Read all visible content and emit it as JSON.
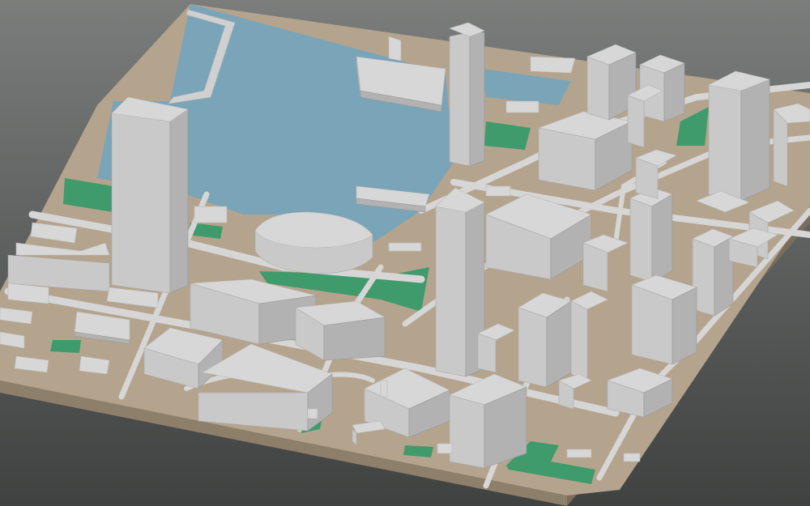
{
  "scene": {
    "description_visible_text": "",
    "colors": {
      "background_top": "#7a7d7b",
      "background_bottom": "#3f4240",
      "ground": "#b5a48d",
      "ground_edge": "#8e7f6a",
      "water": "#7aa4b8",
      "park": "#3f9a6c",
      "road": "#d8d8d8",
      "building_top": "#d7d7d7",
      "building_left": "#c9c9c9",
      "building_right": "#b2b2b2"
    }
  }
}
